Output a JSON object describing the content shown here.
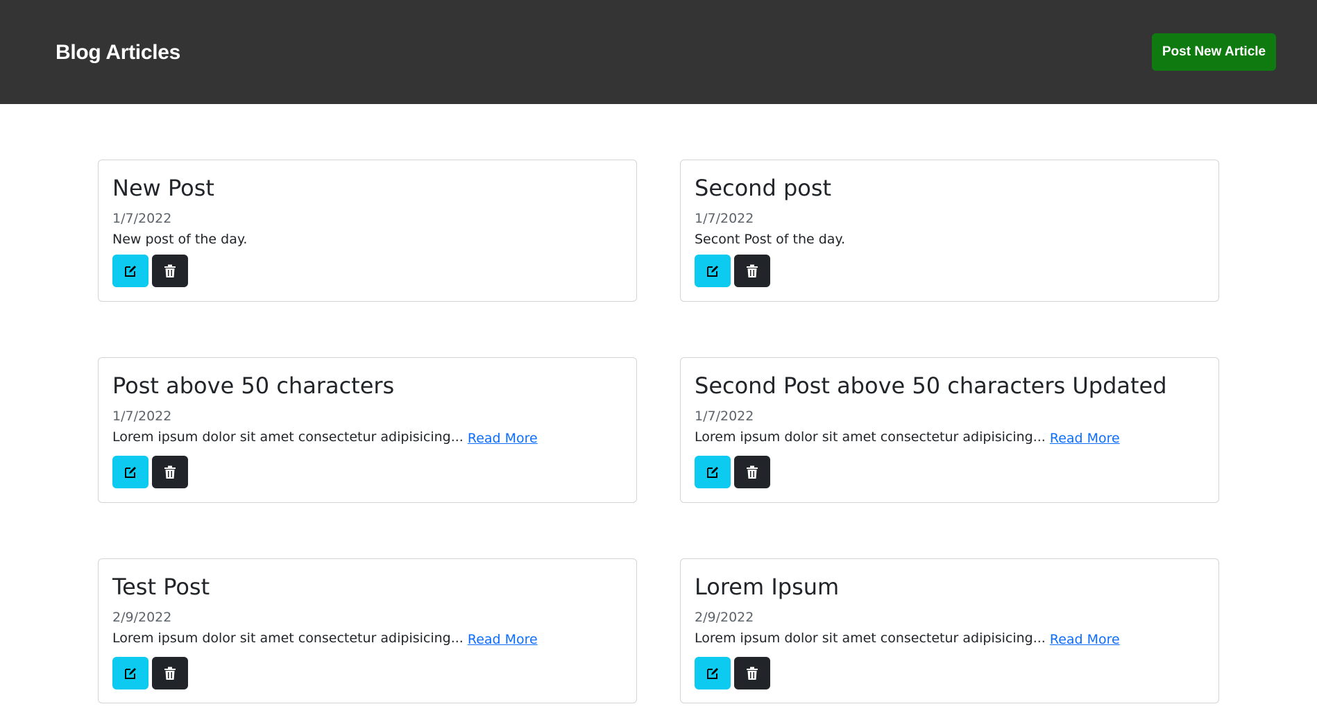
{
  "header": {
    "title": "Blog Articles",
    "post_button_label": "Post New Article",
    "background_color": "#343434",
    "button_color": "#0f7a10"
  },
  "articles": [
    {
      "title": "New Post",
      "date": "1/7/2022",
      "body": "New post of the day.",
      "read_more": ""
    },
    {
      "title": "Second post",
      "date": "1/7/2022",
      "body": "Secont Post of the day.",
      "read_more": ""
    },
    {
      "title": "Post above 50 characters",
      "date": "1/7/2022",
      "body": "Lorem ipsum dolor sit amet consectetur adipisicing...",
      "read_more": "Read More"
    },
    {
      "title": "Second Post above 50 characters Updated",
      "date": "1/7/2022",
      "body": "Lorem ipsum dolor sit amet consectetur adipisicing...",
      "read_more": "Read More"
    },
    {
      "title": "Test Post",
      "date": "2/9/2022",
      "body": "Lorem ipsum dolor sit amet consectetur adipisicing...",
      "read_more": "Read More"
    },
    {
      "title": "Lorem Ipsum",
      "date": "2/9/2022",
      "body": "Lorem ipsum dolor sit amet consectetur adipisicing...",
      "read_more": "Read More"
    }
  ],
  "icons": {
    "edit": "edit-icon",
    "delete": "trash-icon"
  },
  "colors": {
    "edit_button": "#0dcaf0",
    "delete_button": "#212529",
    "link": "#0d6efd"
  }
}
